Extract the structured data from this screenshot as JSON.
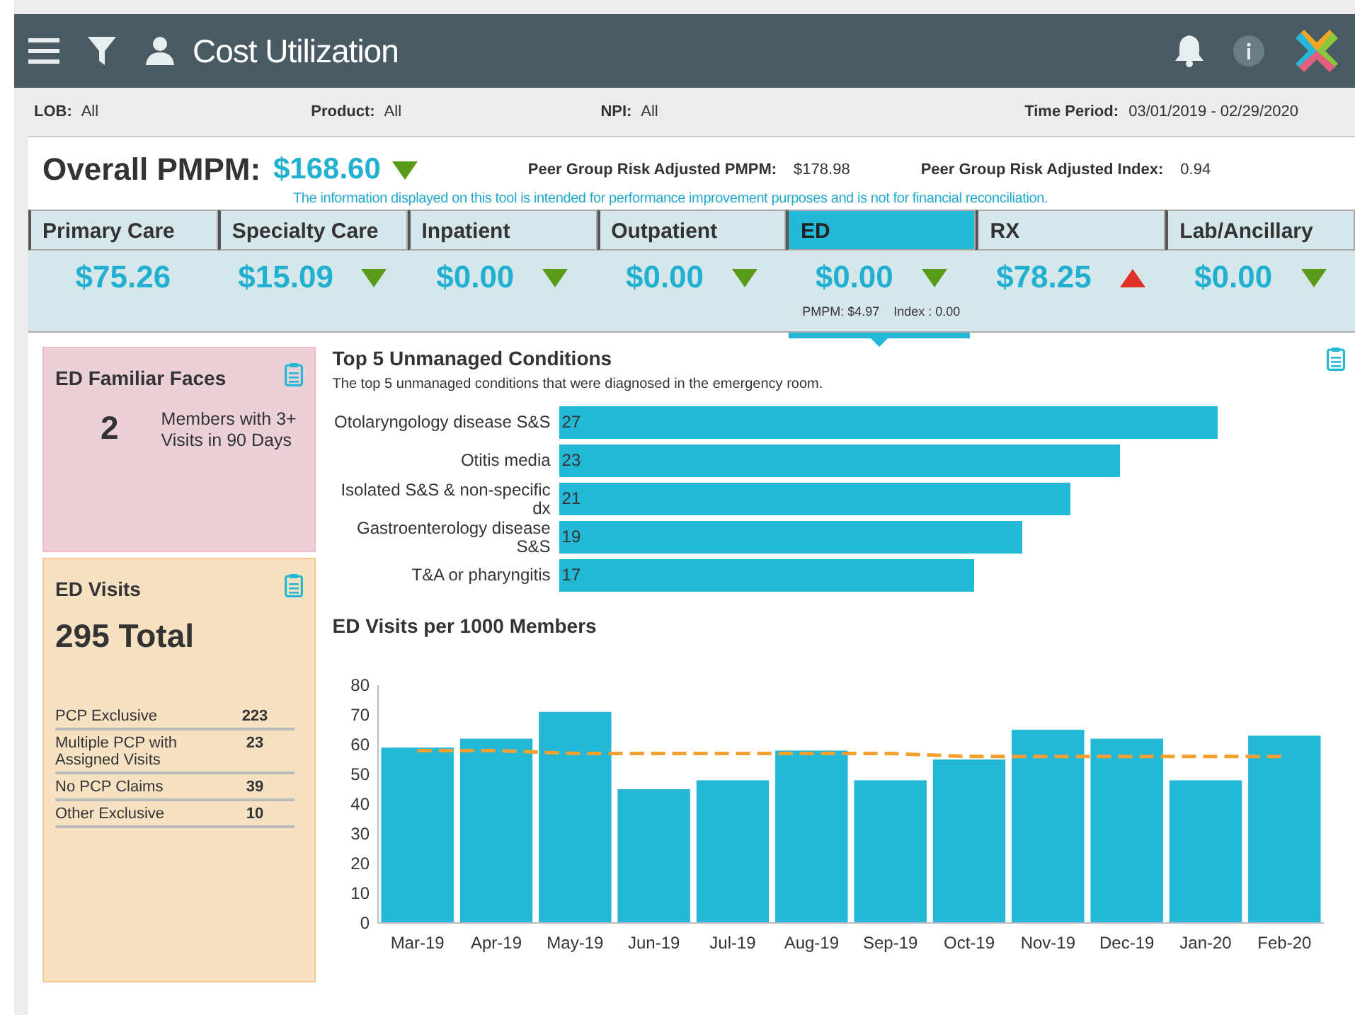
{
  "header": {
    "title": "Cost Utilization"
  },
  "filters": [
    {
      "label": "LOB:",
      "value": "All"
    },
    {
      "label": "Product:",
      "value": "All"
    },
    {
      "label": "NPI:",
      "value": "All"
    },
    {
      "label": "Time Period:",
      "value": "03/01/2019 - 02/29/2020"
    }
  ],
  "overall": {
    "label": "Overall PMPM:",
    "value": "$168.60",
    "trend_down": true,
    "trend_up": false,
    "peer_pmpm_label": "Peer Group Risk Adjusted PMPM:",
    "peer_pmpm": "$178.98",
    "peer_index_label": "Peer Group Risk Adjusted Index:",
    "peer_index": "0.94",
    "disclaimer": "The information displayed on this tool is intended for performance improvement purposes and is not for financial reconciliation."
  },
  "categories": [
    {
      "label": "Primary Care",
      "value": "$75.26",
      "trend_down": false,
      "trend_up": false,
      "selected": false
    },
    {
      "label": "Specialty Care",
      "value": "$15.09",
      "trend_down": true,
      "trend_up": false,
      "selected": false
    },
    {
      "label": "Inpatient",
      "value": "$0.00",
      "trend_down": true,
      "trend_up": false,
      "selected": false
    },
    {
      "label": "Outpatient",
      "value": "$0.00",
      "trend_down": true,
      "trend_up": false,
      "selected": false
    },
    {
      "label": "ED",
      "value": "$0.00",
      "trend_down": true,
      "trend_up": false,
      "selected": true,
      "detail_pmpm": "PMPM: $4.97",
      "detail_index": "Index : 0.00"
    },
    {
      "label": "RX",
      "value": "$78.25",
      "trend_down": false,
      "trend_up": true,
      "selected": false
    },
    {
      "label": "Lab/Ancillary",
      "value": "$0.00",
      "trend_down": true,
      "trend_up": false,
      "selected": false
    }
  ],
  "familiar_faces": {
    "title": "ED Familiar Faces",
    "count": "2",
    "description": "Members with 3+ Visits in 90 Days"
  },
  "ed_visits": {
    "title": "ED Visits",
    "total": "295 Total",
    "rows": [
      {
        "label": "PCP Exclusive",
        "value": "223"
      },
      {
        "label": "Multiple PCP with Assigned Visits",
        "value": "23"
      },
      {
        "label": "No PCP Claims",
        "value": "39"
      },
      {
        "label": "Other Exclusive",
        "value": "10"
      }
    ]
  },
  "top_conditions": {
    "title": "Top 5 Unmanaged Conditions",
    "subtitle": "The top 5 unmanaged conditions that were diagnosed in the emergency room.",
    "chart_data": {
      "type": "bar",
      "orientation": "horizontal",
      "data_labels": true,
      "categories": [
        "Otolaryngology disease S&S",
        "Otitis media",
        "Isolated S&S & non-specific dx",
        "Gastroenterology disease S&S",
        "T&A or pharyngitis"
      ],
      "values": [
        27,
        23,
        21,
        19,
        17
      ]
    }
  },
  "visits_chart": {
    "title": "ED Visits per 1000 Members",
    "chart_data": {
      "type": "bar",
      "categories": [
        "Mar-19",
        "Apr-19",
        "May-19",
        "Jun-19",
        "Jul-19",
        "Aug-19",
        "Sep-19",
        "Oct-19",
        "Nov-19",
        "Dec-19",
        "Jan-20",
        "Feb-20"
      ],
      "ylim": [
        0,
        80
      ],
      "yticks": [
        0,
        10,
        20,
        30,
        40,
        50,
        60,
        70,
        80
      ],
      "series": [
        {
          "type": "bar",
          "color": "#22b8d6",
          "values": [
            59,
            62,
            71,
            45,
            48,
            58,
            48,
            55,
            65,
            62,
            48,
            63
          ]
        },
        {
          "type": "line",
          "line_style": "dashed",
          "color": "#f5a030",
          "values": [
            58,
            58,
            57,
            57,
            57,
            57,
            57,
            56,
            56,
            56,
            56,
            56
          ]
        }
      ]
    }
  }
}
